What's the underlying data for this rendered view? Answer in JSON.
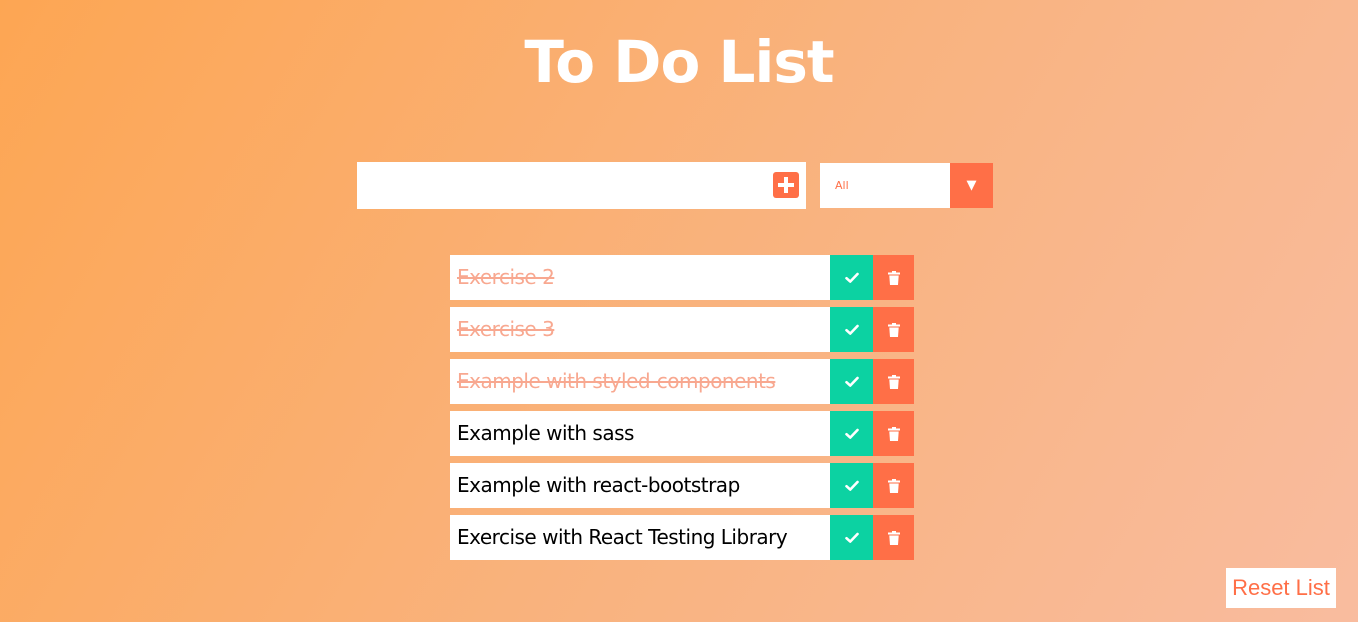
{
  "header": {
    "title": "To Do List"
  },
  "add_form": {
    "input_value": "",
    "input_placeholder": "",
    "add_icon": "plus-square-icon"
  },
  "filter": {
    "selected": "All",
    "arrow_icon": "triangle-down-icon"
  },
  "todos": [
    {
      "text": "Exercise 2",
      "completed": true
    },
    {
      "text": "Exercise 3",
      "completed": true
    },
    {
      "text": "Example with styled-components",
      "completed": true
    },
    {
      "text": "Example with sass",
      "completed": false
    },
    {
      "text": "Example with react-bootstrap",
      "completed": false
    },
    {
      "text": "Exercise with React Testing Library",
      "completed": false
    }
  ],
  "todo_actions": {
    "check_icon": "check-icon",
    "delete_icon": "trash-icon"
  },
  "reset": {
    "label": "Reset List"
  },
  "colors": {
    "accent": "#ff6f47",
    "check": "#0cd2a2",
    "completed_text": "#f8a890",
    "background_start": "#fda653",
    "background_end": "#f9bc9f"
  }
}
